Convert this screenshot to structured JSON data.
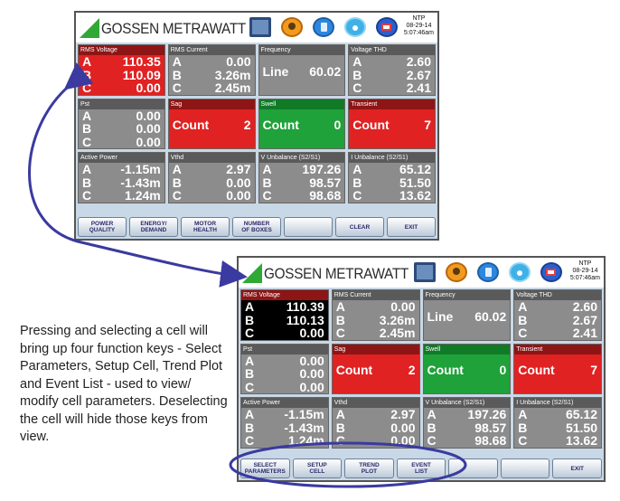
{
  "brand": "GOSSEN METRAWATT",
  "header": {
    "ntp_label": "NTP",
    "date": "08-29-14",
    "time1": "5:07:46am",
    "time2": "5:07:46am"
  },
  "icons": [
    "monitor-icon",
    "people-icon",
    "document-icon",
    "wifi-icon",
    "record-icon"
  ],
  "screen1": {
    "cells": [
      {
        "title": "RMS Voltage",
        "style": "red",
        "rows": [
          [
            "A",
            "110.35"
          ],
          [
            "B",
            "110.09"
          ],
          [
            "C",
            "0.00"
          ]
        ]
      },
      {
        "title": "RMS Current",
        "style": "gray",
        "rows": [
          [
            "A",
            "0.00"
          ],
          [
            "B",
            "3.26m"
          ],
          [
            "C",
            "2.45m"
          ]
        ]
      },
      {
        "title": "Frequency",
        "style": "gray",
        "big": [
          "Line",
          "60.02"
        ]
      },
      {
        "title": "Voltage THD",
        "style": "gray",
        "rows": [
          [
            "A",
            "2.60"
          ],
          [
            "B",
            "2.67"
          ],
          [
            "C",
            "2.41"
          ]
        ]
      },
      {
        "title": "Pst",
        "style": "gray",
        "rows": [
          [
            "A",
            "0.00"
          ],
          [
            "B",
            "0.00"
          ],
          [
            "C",
            "0.00"
          ]
        ]
      },
      {
        "title": "Sag",
        "style": "red",
        "big": [
          "Count",
          "2"
        ]
      },
      {
        "title": "Swell",
        "style": "green",
        "big": [
          "Count",
          "0"
        ]
      },
      {
        "title": "Transient",
        "style": "red",
        "big": [
          "Count",
          "7"
        ]
      },
      {
        "title": "Active Power",
        "style": "gray",
        "rows": [
          [
            "A",
            "-1.15m"
          ],
          [
            "B",
            "-1.43m"
          ],
          [
            "C",
            "1.24m"
          ]
        ]
      },
      {
        "title": "Vthd",
        "style": "gray",
        "rows": [
          [
            "A",
            "2.97"
          ],
          [
            "B",
            "0.00"
          ],
          [
            "C",
            "0.00"
          ]
        ]
      },
      {
        "title": "V Unbalance (S2/S1)",
        "style": "gray",
        "rows": [
          [
            "A",
            "197.26"
          ],
          [
            "B",
            "98.57"
          ],
          [
            "C",
            "98.68"
          ]
        ]
      },
      {
        "title": "I Unbalance (S2/S1)",
        "style": "gray",
        "rows": [
          [
            "A",
            "65.12"
          ],
          [
            "B",
            "51.50"
          ],
          [
            "C",
            "13.62"
          ]
        ]
      }
    ],
    "buttons": [
      "POWER\nQUALITY",
      "ENERGY/\nDEMAND",
      "MOTOR\nHEALTH",
      "NUMBER\nOF BOXES",
      "",
      "CLEAR",
      "EXIT"
    ]
  },
  "screen2": {
    "cells": [
      {
        "title": "RMS Voltage",
        "style": "blk",
        "rows": [
          [
            "A",
            "110.39"
          ],
          [
            "B",
            "110.13"
          ],
          [
            "C",
            "0.00"
          ]
        ]
      },
      {
        "title": "RMS Current",
        "style": "gray",
        "rows": [
          [
            "A",
            "0.00"
          ],
          [
            "B",
            "3.26m"
          ],
          [
            "C",
            "2.45m"
          ]
        ]
      },
      {
        "title": "Frequency",
        "style": "gray",
        "big": [
          "Line",
          "60.02"
        ]
      },
      {
        "title": "Voltage THD",
        "style": "gray",
        "rows": [
          [
            "A",
            "2.60"
          ],
          [
            "B",
            "2.67"
          ],
          [
            "C",
            "2.41"
          ]
        ]
      },
      {
        "title": "Pst",
        "style": "gray",
        "rows": [
          [
            "A",
            "0.00"
          ],
          [
            "B",
            "0.00"
          ],
          [
            "C",
            "0.00"
          ]
        ]
      },
      {
        "title": "Sag",
        "style": "red",
        "big": [
          "Count",
          "2"
        ]
      },
      {
        "title": "Swell",
        "style": "green",
        "big": [
          "Count",
          "0"
        ]
      },
      {
        "title": "Transient",
        "style": "red",
        "big": [
          "Count",
          "7"
        ]
      },
      {
        "title": "Active Power",
        "style": "gray",
        "rows": [
          [
            "A",
            "-1.15m"
          ],
          [
            "B",
            "-1.43m"
          ],
          [
            "C",
            "1.24m"
          ]
        ]
      },
      {
        "title": "Vthd",
        "style": "gray",
        "rows": [
          [
            "A",
            "2.97"
          ],
          [
            "B",
            "0.00"
          ],
          [
            "C",
            "0.00"
          ]
        ]
      },
      {
        "title": "V Unbalance (S2/S1)",
        "style": "gray",
        "rows": [
          [
            "A",
            "197.26"
          ],
          [
            "B",
            "98.57"
          ],
          [
            "C",
            "98.68"
          ]
        ]
      },
      {
        "title": "I Unbalance (S2/S1)",
        "style": "gray",
        "rows": [
          [
            "A",
            "65.12"
          ],
          [
            "B",
            "51.50"
          ],
          [
            "C",
            "13.62"
          ]
        ]
      }
    ],
    "buttons": [
      "SELECT\nPARAMETERS",
      "SETUP\nCELL",
      "TREND\nPLOT",
      "EVENT\nLIST",
      "",
      "",
      "EXIT"
    ]
  },
  "caption": "Pressing and selecting a cell will bring up four function keys - Select Parameters, Setup Cell, Trend Plot and Event List - used to view/ modify cell parameters. Deselecting the cell will hide those keys from view.",
  "colors": {
    "brand_green": "#2fa836",
    "alarm_red": "#e02222",
    "ok_green": "#1fa23a",
    "cell_gray": "#8c8c8c",
    "callout_blue": "#3a3aa0"
  }
}
